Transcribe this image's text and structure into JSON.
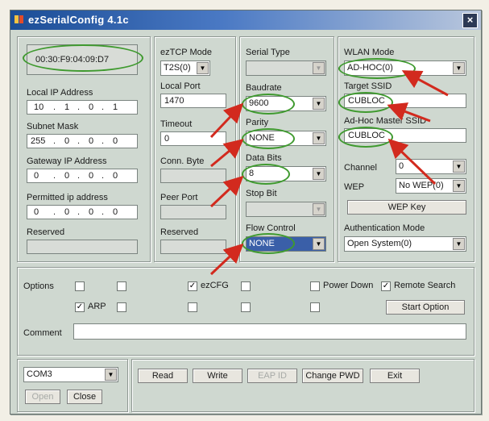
{
  "window": {
    "title": "ezSerialConfig 4.1c",
    "close_glyph": "×"
  },
  "network": {
    "mac": "00:30:F9:04:09:D7",
    "local_ip_label": "Local IP Address",
    "local_ip": [
      "10",
      "1",
      "0",
      "1"
    ],
    "subnet_label": "Subnet Mask",
    "subnet": [
      "255",
      "0",
      "0",
      "0"
    ],
    "gateway_label": "Gateway IP Address",
    "gateway": [
      "0",
      "0",
      "0",
      "0"
    ],
    "permitted_label": "Permitted ip address",
    "permitted": [
      "0",
      "0",
      "0",
      "0"
    ],
    "reserved_label": "Reserved"
  },
  "eztcp": {
    "mode_label": "ezTCP Mode",
    "mode": "T2S(0)",
    "local_port_label": "Local Port",
    "local_port": "1470",
    "timeout_label": "Timeout",
    "timeout": "0",
    "conn_byte_label": "Conn. Byte",
    "peer_port_label": "Peer Port",
    "reserved_label": "Reserved"
  },
  "serial": {
    "type_label": "Serial Type",
    "baudrate_label": "Baudrate",
    "baudrate": "9600",
    "parity_label": "Parity",
    "parity": "NONE",
    "databits_label": "Data Bits",
    "databits": "8",
    "stopbit_label": "Stop Bit",
    "flow_label": "Flow Control",
    "flow": "NONE"
  },
  "wlan": {
    "mode_label": "WLAN Mode",
    "mode": "AD-HOC(0)",
    "target_ssid_label": "Target SSID",
    "target_ssid": "CUBLOC",
    "adhoc_ssid_label": "Ad-Hoc Master SSID",
    "adhoc_ssid": "CUBLOC",
    "channel_label": "Channel",
    "channel": "0",
    "wep_label": "WEP",
    "wep": "No WEP(0)",
    "wep_key_button": "WEP Key",
    "auth_label": "Authentication Mode",
    "auth": "Open System(0)"
  },
  "options": {
    "label": "Options",
    "arp": "ARP",
    "ezcfg": "ezCFG",
    "power_down": "Power Down",
    "remote_search": "Remote Search",
    "start_option": "Start Option",
    "comment_label": "Comment"
  },
  "bottom": {
    "port": "COM3",
    "open": "Open",
    "close": "Close",
    "read": "Read",
    "write": "Write",
    "eap_id": "EAP ID",
    "change_pwd": "Change PWD",
    "exit": "Exit"
  },
  "icons": {
    "dropdown": "▼",
    "check": "✓"
  },
  "colors": {
    "annotation_oval": "#3f9a2f",
    "annotation_arrow": "#d22a1e",
    "titlebar": "#1b4d96"
  }
}
